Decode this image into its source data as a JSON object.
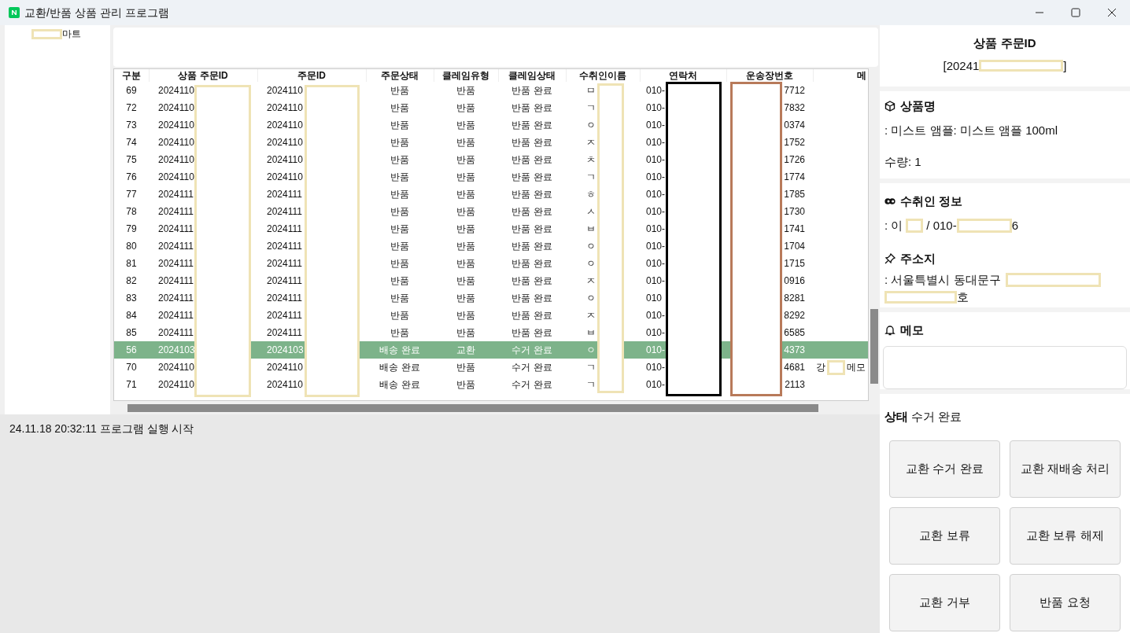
{
  "window": {
    "title": "교환/반품 상품 관리 프로그램"
  },
  "sidebar": {
    "items": [
      {
        "label": "마트",
        "selected": false
      }
    ]
  },
  "table": {
    "columns": [
      "구분",
      "상품 주문ID",
      "주문ID",
      "주문상태",
      "클레임유형",
      "클레임상태",
      "수취인이름",
      "연락처",
      "운송장번호",
      "메"
    ],
    "rows": [
      {
        "cells": [
          "69",
          "2024110",
          "2024110",
          "반품",
          "반품",
          "반품 완료",
          "ㅁ",
          "010-",
          "7712",
          ""
        ],
        "selected": false
      },
      {
        "cells": [
          "72",
          "2024110",
          "2024110",
          "반품",
          "반품",
          "반품 완료",
          "ㄱ",
          "010-",
          "7832",
          ""
        ],
        "selected": false
      },
      {
        "cells": [
          "73",
          "2024110",
          "2024110",
          "반품",
          "반품",
          "반품 완료",
          "ㅇ",
          "010-",
          "0374",
          ""
        ],
        "selected": false
      },
      {
        "cells": [
          "74",
          "2024110",
          "2024110",
          "반품",
          "반품",
          "반품 완료",
          "ㅈ",
          "010-",
          "1752",
          ""
        ],
        "selected": false
      },
      {
        "cells": [
          "75",
          "2024110",
          "2024110",
          "반품",
          "반품",
          "반품 완료",
          "ㅊ",
          "010-",
          "1726",
          ""
        ],
        "selected": false
      },
      {
        "cells": [
          "76",
          "2024110",
          "2024110",
          "반품",
          "반품",
          "반품 완료",
          "ㄱ",
          "010-",
          "1774",
          ""
        ],
        "selected": false
      },
      {
        "cells": [
          "77",
          "2024111",
          "2024111",
          "반품",
          "반품",
          "반품 완료",
          "ㅎ",
          "010-",
          "1785",
          ""
        ],
        "selected": false
      },
      {
        "cells": [
          "78",
          "2024111",
          "2024111",
          "반품",
          "반품",
          "반품 완료",
          "ㅅ",
          "010-",
          "1730",
          ""
        ],
        "selected": false
      },
      {
        "cells": [
          "79",
          "2024111",
          "2024111",
          "반품",
          "반품",
          "반품 완료",
          "ㅂ",
          "010-",
          "1741",
          ""
        ],
        "selected": false
      },
      {
        "cells": [
          "80",
          "2024111",
          "2024111",
          "반품",
          "반품",
          "반품 완료",
          "ㅇ",
          "010-",
          "1704",
          ""
        ],
        "selected": false
      },
      {
        "cells": [
          "81",
          "2024111",
          "2024111",
          "반품",
          "반품",
          "반품 완료",
          "ㅇ",
          "010-",
          "1715",
          ""
        ],
        "selected": false
      },
      {
        "cells": [
          "82",
          "2024111",
          "2024111",
          "반품",
          "반품",
          "반품 완료",
          "ㅈ",
          "010-",
          "0916",
          ""
        ],
        "selected": false
      },
      {
        "cells": [
          "83",
          "2024111",
          "2024111",
          "반품",
          "반품",
          "반품 완료",
          "ㅇ",
          "010",
          "8281",
          ""
        ],
        "selected": false
      },
      {
        "cells": [
          "84",
          "2024111",
          "2024111",
          "반품",
          "반품",
          "반품 완료",
          "ㅈ",
          "010-",
          "8292",
          ""
        ],
        "selected": false
      },
      {
        "cells": [
          "85",
          "2024111",
          "2024111",
          "반품",
          "반품",
          "반품 완료",
          "ㅂ",
          "010-",
          "6585",
          ""
        ],
        "selected": false
      },
      {
        "cells": [
          "56",
          "2024103",
          "2024103",
          "배송 완료",
          "교환",
          "수거 완료",
          "ㅇ",
          "010-",
          "4373",
          ""
        ],
        "selected": true
      },
      {
        "cells": [
          "70",
          "2024110",
          "2024110",
          "배송 완료",
          "반품",
          "수거 완료",
          "ㄱ",
          "010-",
          "4681",
          ""
        ],
        "memo": [
          "강",
          "메모"
        ],
        "selected": false
      },
      {
        "cells": [
          "71",
          "2024110",
          "2024110",
          "배송 완료",
          "반품",
          "수거 완료",
          "ㄱ",
          "010-",
          "2113",
          ""
        ],
        "selected": false
      }
    ]
  },
  "log": [
    "24.11.18 20:32:11 프로그램 실행 시작"
  ],
  "detail": {
    "id_title": "상품 주문ID",
    "id_prefix": "[20241",
    "id_suffix": "]",
    "product_title": "상품명",
    "product_name": ": 미스트 앰플: 미스트 앰플 100ml",
    "quantity": "수량: 1",
    "recipient_title": "수취인 정보",
    "recipient_prefix": ": 이",
    "recipient_mid": "/ 010-",
    "recipient_suffix": "6",
    "address_title": "주소지",
    "address_line1": ": 서울특별시 동대문구",
    "address_line2_suffix": "호",
    "memo_title": "메모"
  },
  "status": {
    "label": "상태",
    "value": "수거 완료"
  },
  "buttons": [
    "교환 수거 완료",
    "교환 재배송 처리",
    "교환 보류",
    "교환 보류 해제",
    "교환 거부",
    "반품 요청"
  ]
}
